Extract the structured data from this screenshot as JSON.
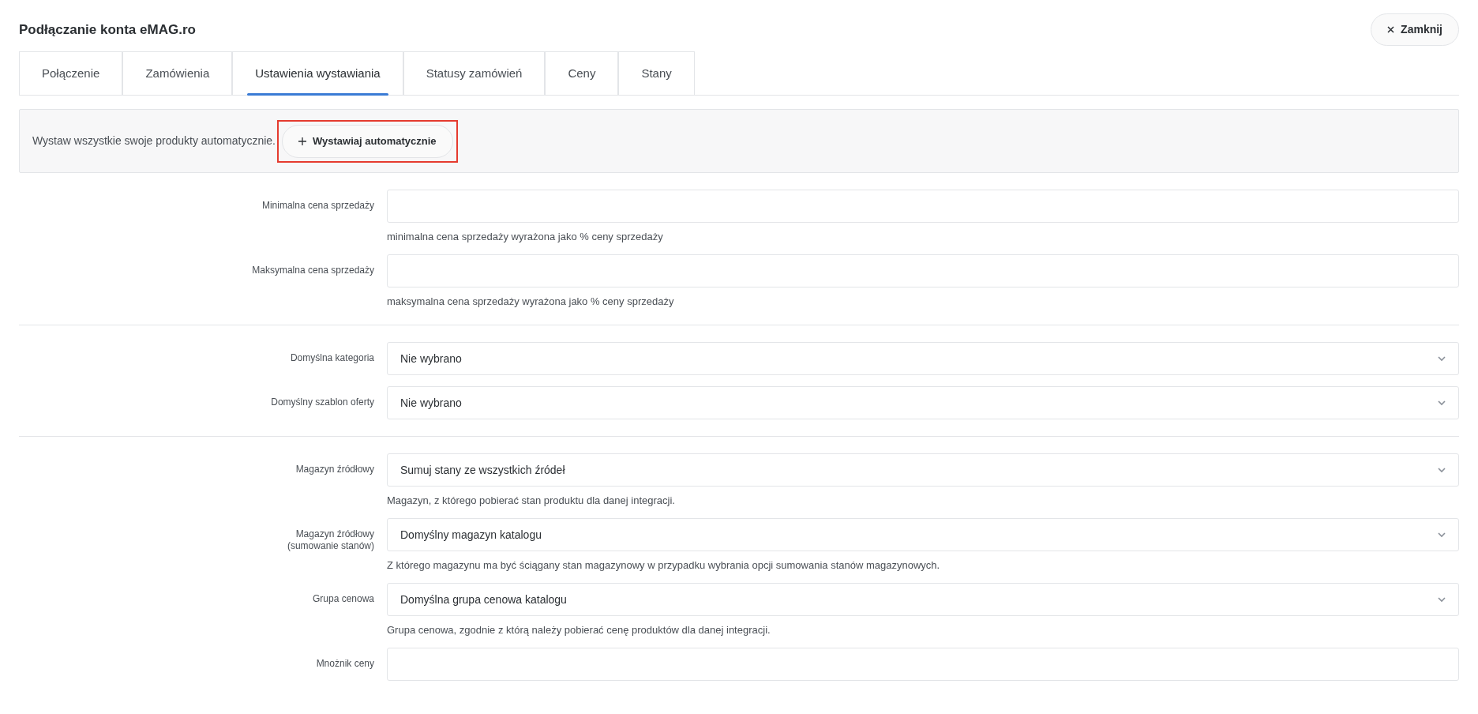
{
  "title": "Podłączanie konta eMAG.ro",
  "close_button": {
    "label": "Zamknij"
  },
  "tabs": [
    {
      "label": "Połączenie",
      "selected": false
    },
    {
      "label": "Zamówienia",
      "selected": false
    },
    {
      "label": "Ustawienia wystawiania",
      "selected": true
    },
    {
      "label": "Statusy zamówień",
      "selected": false
    },
    {
      "label": "Ceny",
      "selected": false
    },
    {
      "label": "Stany",
      "selected": false
    }
  ],
  "banner": {
    "text": "Wystaw wszystkie swoje produkty automatycznie.",
    "button": {
      "label": "Wystawiaj automatycznie",
      "highlighted": true
    }
  },
  "sections": [
    {
      "fields": [
        {
          "kind": "text",
          "label": "Minimalna cena sprzedaży",
          "help": "minimalna cena sprzedaży wyrażona jako % ceny sprzedaży"
        },
        {
          "kind": "text",
          "label": "Maksymalna cena sprzedaży",
          "help": "maksymalna cena sprzedaży wyrażona jako % ceny sprzedaży"
        }
      ]
    },
    {
      "fields": [
        {
          "kind": "select",
          "label": "Domyślna kategoria",
          "value": "Nie wybrano"
        },
        {
          "kind": "select",
          "label": "Domyślny szablon oferty",
          "value": "Nie wybrano"
        }
      ]
    },
    {
      "fields": [
        {
          "kind": "select",
          "label": "Magazyn źródłowy",
          "value": "Sumuj stany ze wszystkich źródeł",
          "help": "Magazyn, z którego pobierać stan produktu dla danej integracji."
        },
        {
          "kind": "select",
          "label": "Magazyn źródłowy",
          "sublabel": "(sumowanie stanów)",
          "value": "Domyślny magazyn katalogu",
          "help": "Z którego magazynu ma być ściągany stan magazynowy w przypadku wybrania opcji sumowania stanów magazynowych."
        },
        {
          "kind": "select",
          "label": "Grupa cenowa",
          "value": "Domyślna grupa cenowa katalogu",
          "help": "Grupa cenowa, zgodnie z którą należy pobierać cenę produktów dla danej integracji."
        },
        {
          "kind": "text",
          "label": "Mnożnik ceny"
        }
      ]
    }
  ]
}
